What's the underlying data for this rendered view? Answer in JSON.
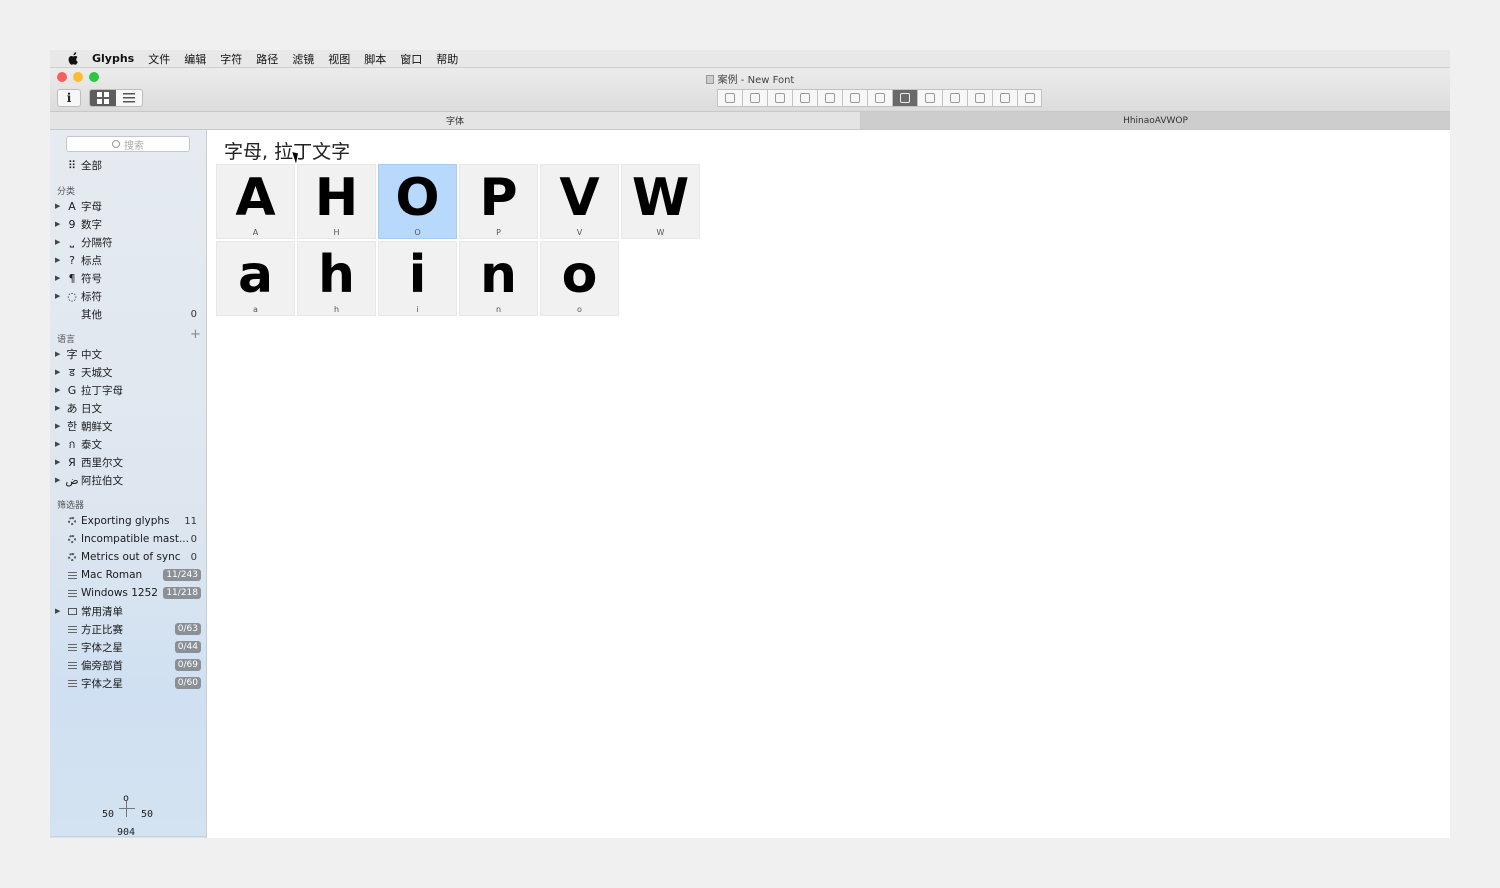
{
  "menubar": {
    "app": "Glyphs",
    "items": [
      "文件",
      "编辑",
      "字符",
      "路径",
      "滤镜",
      "视图",
      "脚本",
      "窗口",
      "帮助"
    ]
  },
  "window": {
    "title": "案例 - New Font"
  },
  "toolbar": {
    "info_label": "i"
  },
  "tabs": {
    "font": "字体",
    "text": "HhinaoAVWOP"
  },
  "sidebar": {
    "search_placeholder": "搜索",
    "all": {
      "icon": "⠿",
      "label": "全部"
    },
    "categories_heading": "分类",
    "categories": [
      {
        "icon": "A",
        "label": "字母"
      },
      {
        "icon": "9",
        "label": "数字"
      },
      {
        "icon": "⎵",
        "label": "分隔符"
      },
      {
        "icon": "?",
        "label": "标点"
      },
      {
        "icon": "¶",
        "label": "符号"
      },
      {
        "icon": "◌",
        "label": "标符"
      }
    ],
    "other": {
      "label": "其他",
      "count": "0"
    },
    "languages_heading": "语言",
    "add_symbol": "+",
    "languages": [
      {
        "icon": "字",
        "label": "中文"
      },
      {
        "icon": "ड",
        "label": "天城文"
      },
      {
        "icon": "G",
        "label": "拉丁字母"
      },
      {
        "icon": "あ",
        "label": "日文"
      },
      {
        "icon": "한",
        "label": "朝鲜文"
      },
      {
        "icon": "ก",
        "label": "泰文"
      },
      {
        "icon": "Я",
        "label": "西里尔文"
      },
      {
        "icon": "ض",
        "label": "阿拉伯文"
      }
    ],
    "filters_heading": "筛选器",
    "smart_filters": [
      {
        "label": "Exporting glyphs",
        "count": "11"
      },
      {
        "label": "Incompatible mast...",
        "count": "0"
      },
      {
        "label": "Metrics out of sync",
        "count": "0"
      }
    ],
    "lists": [
      {
        "label": "Mac Roman",
        "badge": "11/243"
      },
      {
        "label": "Windows 1252",
        "badge": "11/218"
      }
    ],
    "folder": {
      "label": "常用清单"
    },
    "lists2": [
      {
        "label": "方正比赛",
        "badge": "0/63"
      },
      {
        "label": "字体之星",
        "badge": "0/44"
      },
      {
        "label": "偏旁部首",
        "badge": "0/69"
      },
      {
        "label": "字体之星",
        "badge": "0/60"
      }
    ],
    "metrics": {
      "name": "o",
      "lsb": "50",
      "rsb": "50",
      "width": "904"
    }
  },
  "main": {
    "heading": "字母, 拉丁文字",
    "row1": [
      {
        "glyph": "A",
        "name": "A"
      },
      {
        "glyph": "H",
        "name": "H"
      },
      {
        "glyph": "O",
        "name": "O"
      },
      {
        "glyph": "P",
        "name": "P"
      },
      {
        "glyph": "V",
        "name": "V"
      },
      {
        "glyph": "W",
        "name": "W"
      }
    ],
    "row2": [
      {
        "glyph": "a",
        "name": "a"
      },
      {
        "glyph": "h",
        "name": "h"
      },
      {
        "glyph": "i",
        "name": "i"
      },
      {
        "glyph": "n",
        "name": "n"
      },
      {
        "glyph": "o",
        "name": "o"
      }
    ]
  },
  "colors": {
    "selection": "#b8d9fb",
    "cell": "#f1f1f1",
    "close": "#fc5f57",
    "minimize": "#fdbc2e",
    "zoom": "#28c840"
  }
}
